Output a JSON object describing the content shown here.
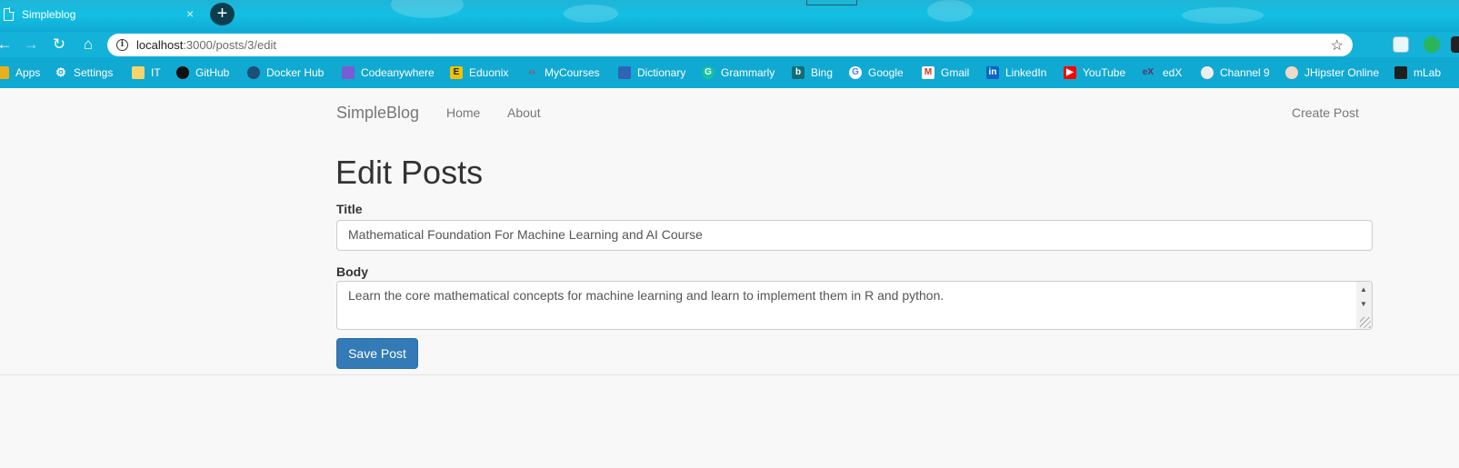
{
  "browser": {
    "tab_title": "Simpleblog",
    "tab_close": "×",
    "new_tab": "+",
    "url_host": "localhost",
    "url_path": ":3000/posts/3/edit",
    "colors": {
      "chrome": "#14b2d9",
      "bookmarks_bar": "#10a9d2"
    }
  },
  "bookmarks": [
    {
      "label": "Apps",
      "icon": "apps-grid-icon",
      "color": "#e8b01c"
    },
    {
      "label": "Settings",
      "icon": "gear-icon",
      "color": "#ffffff"
    },
    {
      "label": "IT",
      "icon": "folder-icon",
      "color": "#f6d46a"
    },
    {
      "label": "GitHub",
      "icon": "github-icon",
      "color": "#111111"
    },
    {
      "label": "Docker Hub",
      "icon": "docker-icon",
      "color": "#1b4f76"
    },
    {
      "label": "Codeanywhere",
      "icon": "codeanywhere-icon",
      "color": "#7b5bd1"
    },
    {
      "label": "Eduonix",
      "icon": "eduonix-icon",
      "color": "#f2c200"
    },
    {
      "label": "MyCourses",
      "icon": "mycourses-icon",
      "color": "#c33a3a"
    },
    {
      "label": "Dictionary",
      "icon": "dictionary-icon",
      "color": "#2e64b5"
    },
    {
      "label": "Grammarly",
      "icon": "grammarly-icon",
      "color": "#15c39a"
    },
    {
      "label": "Bing",
      "icon": "bing-icon",
      "color": "#106e76"
    },
    {
      "label": "Google",
      "icon": "google-icon",
      "color": "#ffffff"
    },
    {
      "label": "Gmail",
      "icon": "gmail-icon",
      "color": "#d93025"
    },
    {
      "label": "LinkedIn",
      "icon": "linkedin-icon",
      "color": "#0a66c2"
    },
    {
      "label": "YouTube",
      "icon": "youtube-icon",
      "color": "#ff0000"
    },
    {
      "label": "edX",
      "icon": "edx-icon",
      "color": "#5b2f6b"
    },
    {
      "label": "Channel 9",
      "icon": "channel9-icon",
      "color": "#eeeeee"
    },
    {
      "label": "JHipster Online",
      "icon": "jhipster-icon",
      "color": "#f0d9c7"
    },
    {
      "label": "mLab",
      "icon": "mlab-icon",
      "color": "#1f1f1f"
    }
  ],
  "navbar": {
    "brand": "SimpleBlog",
    "links": [
      "Home",
      "About"
    ],
    "right_link": "Create Post"
  },
  "form": {
    "heading": "Edit Posts",
    "title_label": "Title",
    "title_value": "Mathematical Foundation For Machine Learning and AI Course",
    "body_label": "Body",
    "body_line1": "Learn the core mathematical concepts for machine learning and learn to implement them in R and python.",
    "submit_label": "Save Post"
  },
  "theme": {
    "primary": "#337ab7",
    "text": "#333333",
    "muted": "#777777"
  }
}
